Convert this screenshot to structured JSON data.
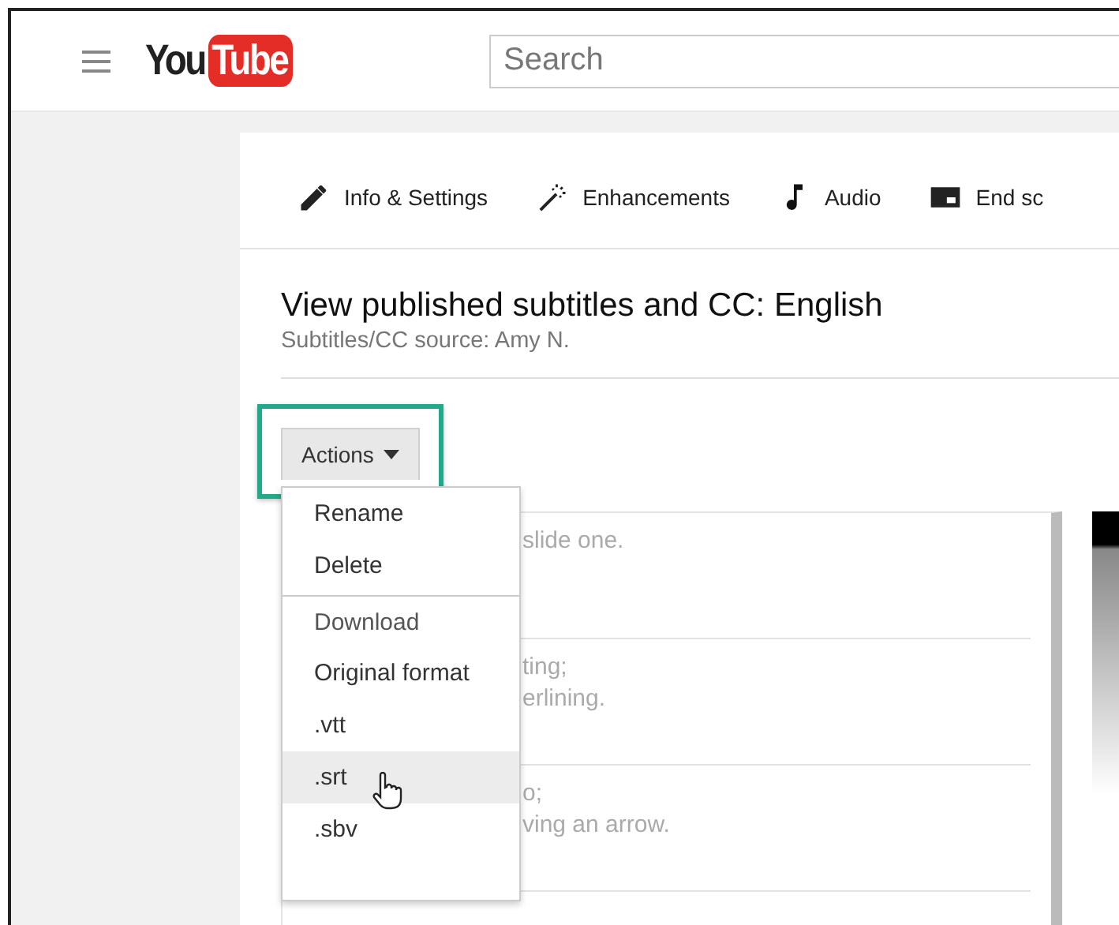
{
  "header": {
    "logo": {
      "you": "You",
      "tube": "Tube"
    },
    "search": {
      "placeholder": "Search"
    }
  },
  "tabs": [
    {
      "label": "Info & Settings",
      "kind": "pencil"
    },
    {
      "label": "Enhancements",
      "kind": "wand"
    },
    {
      "label": "Audio",
      "kind": "note"
    },
    {
      "label": "End sc",
      "kind": "endscreen"
    }
  ],
  "heading": {
    "title": "View published subtitles and CC: English",
    "source": "Subtitles/CC source: Amy N."
  },
  "actions_button": {
    "label": "Actions",
    "highlighted": true
  },
  "actions_menu": [
    {
      "label": "Rename",
      "kind": "item",
      "selected": false
    },
    {
      "label": "Delete",
      "kind": "item",
      "selected": false
    },
    {
      "label": "Download",
      "kind": "header",
      "selected": false
    },
    {
      "label": "Original format",
      "kind": "item",
      "selected": false
    },
    {
      "label": ".vtt",
      "kind": "item",
      "selected": false
    },
    {
      "label": ".srt",
      "kind": "item",
      "selected": true
    },
    {
      "label": ".sbv",
      "kind": "item",
      "selected": false
    }
  ],
  "subtitle_rows": [
    {
      "lines": [
        "slide one."
      ]
    },
    {
      "lines": [
        "ting;",
        "erlining."
      ]
    },
    {
      "lines": [
        "o;",
        "ving an arrow."
      ]
    }
  ]
}
